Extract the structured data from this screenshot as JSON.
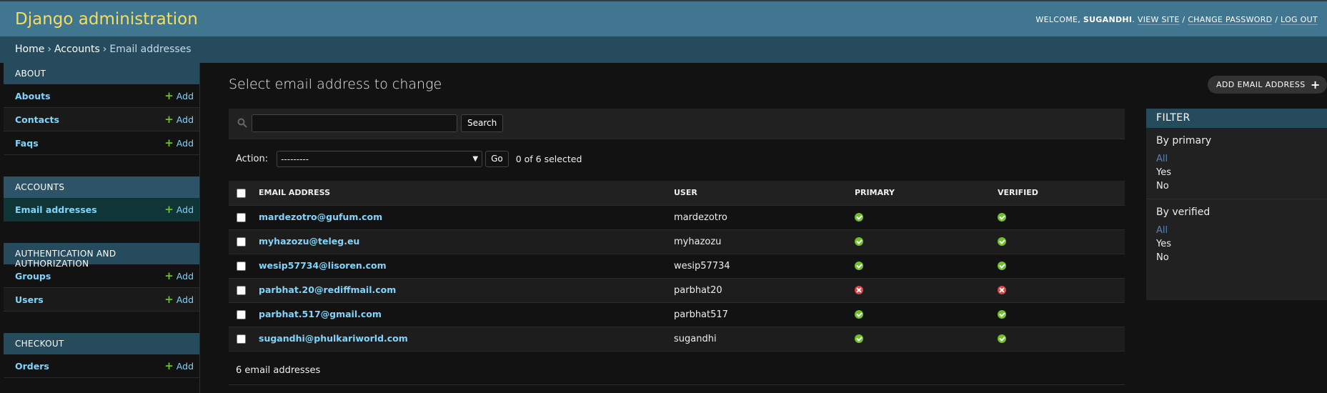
{
  "header": {
    "site_name": "Django administration",
    "welcome": "WELCOME,",
    "username": "SUGANDHI",
    "view_site": "VIEW SITE",
    "change_password": "CHANGE PASSWORD",
    "log_out": "LOG OUT",
    "separator": "/"
  },
  "breadcrumbs": {
    "home": "Home",
    "accounts": "Accounts",
    "current": "Email addresses",
    "sep": "›"
  },
  "sidebar": {
    "add_label": "Add",
    "modules": [
      {
        "caption": "ABOUT",
        "items": [
          "Abouts",
          "Contacts",
          "Faqs"
        ]
      },
      {
        "caption": "ACCOUNTS",
        "items": [
          "Email addresses"
        ]
      },
      {
        "caption": "AUTHENTICATION AND AUTHORIZATION",
        "items": [
          "Groups",
          "Users"
        ]
      },
      {
        "caption": "CHECKOUT",
        "items": [
          "Orders"
        ]
      }
    ]
  },
  "main": {
    "title": "Select email address to change",
    "add_button": "ADD EMAIL ADDRESS",
    "search": {
      "value": "",
      "placeholder": "",
      "button": "Search"
    },
    "actions": {
      "label": "Action:",
      "selected": "---------",
      "go": "Go",
      "counter": "0 of 6 selected"
    },
    "columns": [
      "EMAIL ADDRESS",
      "USER",
      "PRIMARY",
      "VERIFIED"
    ],
    "rows": [
      {
        "email": "mardezotro@gufum.com",
        "user": "mardezotro",
        "primary": true,
        "verified": true
      },
      {
        "email": "myhazozu@teleg.eu",
        "user": "myhazozu",
        "primary": true,
        "verified": true
      },
      {
        "email": "wesip57734@lisoren.com",
        "user": "wesip57734",
        "primary": true,
        "verified": true
      },
      {
        "email": "parbhat.20@rediffmail.com",
        "user": "parbhat20",
        "primary": false,
        "verified": false
      },
      {
        "email": "parbhat.517@gmail.com",
        "user": "parbhat517",
        "primary": true,
        "verified": true
      },
      {
        "email": "sugandhi@phulkariworld.com",
        "user": "sugandhi",
        "primary": true,
        "verified": true
      }
    ],
    "paginator": "6 email addresses"
  },
  "filter": {
    "title": "FILTER",
    "sections": [
      {
        "heading": "By primary",
        "options": [
          "All",
          "Yes",
          "No"
        ],
        "selected": "All"
      },
      {
        "heading": "By verified",
        "options": [
          "All",
          "Yes",
          "No"
        ],
        "selected": "All"
      }
    ]
  },
  "colors": {
    "header_bg": "#417690",
    "breadcrumbs_bg": "#264b5d",
    "site_name": "#f5dd5d",
    "link": "#81d4fa",
    "yes": "#70bf2b",
    "no": "#dd4646",
    "current_row": "#0f3536"
  }
}
